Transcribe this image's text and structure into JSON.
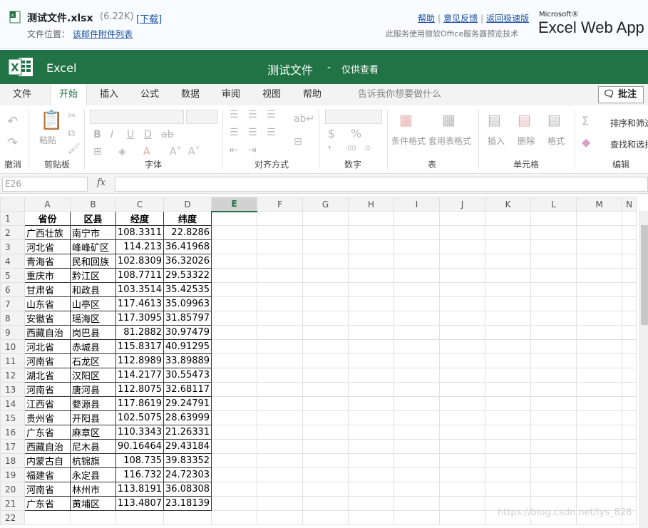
{
  "header": {
    "file_name": "测试文件.xlsx",
    "file_size": "(6.22K)",
    "download_label": "[下载]",
    "location_label": "文件位置：",
    "location_value": "该邮件附件列表",
    "links": [
      "帮助",
      "意见反馈",
      "返回极速版"
    ],
    "service_note": "此服务使用微软Office服务器预览技术",
    "brand_small": "Microsoft®",
    "brand": "Excel Web App"
  },
  "appbar": {
    "app_name": "Excel",
    "doc_title": "测试文件",
    "separator": "-",
    "mode": "仅供查看"
  },
  "tabs": [
    "文件",
    "开始",
    "插入",
    "公式",
    "数据",
    "审阅",
    "视图",
    "帮助"
  ],
  "active_tab": "开始",
  "tell_me": "告诉我你想要做什么",
  "note_button": "批注",
  "ribbon": {
    "groups": [
      "撤消",
      "剪贴板",
      "字体",
      "对齐方式",
      "数字",
      "表",
      "单元格",
      "编辑"
    ],
    "paste": "粘贴",
    "conditional_format": "条件格式",
    "table_format": "套用表格式",
    "insert": "插入",
    "delete": "删除",
    "format": "格式",
    "sort_filter": "排序和筛选",
    "find_select": "查找和选择"
  },
  "formula_bar": {
    "name_box": "E26",
    "fx": "fx",
    "formula": ""
  },
  "sheet": {
    "columns": [
      "A",
      "B",
      "C",
      "D",
      "E",
      "F",
      "G",
      "H",
      "I",
      "J",
      "K",
      "L",
      "M",
      "N"
    ],
    "selected_column": "E",
    "header_row": [
      "省份",
      "区县",
      "经度",
      "纬度"
    ],
    "rows": [
      [
        "广西壮族",
        "南宁市",
        "108.3311",
        "22.8286"
      ],
      [
        "河北省",
        "峰峰矿区",
        "114.213",
        "36.41968"
      ],
      [
        "青海省",
        "民和回族",
        "102.8309",
        "36.32026"
      ],
      [
        "重庆市",
        "黔江区",
        "108.7711",
        "29.53322"
      ],
      [
        "甘肃省",
        "和政县",
        "103.3514",
        "35.42535"
      ],
      [
        "山东省",
        "山亭区",
        "117.4613",
        "35.09963"
      ],
      [
        "安徽省",
        "瑶海区",
        "117.3095",
        "31.85797"
      ],
      [
        "西藏自治",
        "岗巴县",
        "81.2882",
        "30.97479"
      ],
      [
        "河北省",
        "赤城县",
        "115.8317",
        "40.91295"
      ],
      [
        "河南省",
        "石龙区",
        "112.8989",
        "33.89889"
      ],
      [
        "湖北省",
        "汉阳区",
        "114.2177",
        "30.55473"
      ],
      [
        "河南省",
        "唐河县",
        "112.8075",
        "32.68117"
      ],
      [
        "江西省",
        "婺源县",
        "117.8619",
        "29.24791"
      ],
      [
        "贵州省",
        "开阳县",
        "102.5075",
        "28.63999"
      ],
      [
        "广东省",
        "麻章区",
        "110.3343",
        "21.26331"
      ],
      [
        "西藏自治",
        "尼木县",
        "90.16464",
        "29.43184"
      ],
      [
        "内蒙古自",
        "杭锦旗",
        "108.735",
        "39.83352"
      ],
      [
        "福建省",
        "永定县",
        "116.732",
        "24.72303"
      ],
      [
        "河南省",
        "林州市",
        "113.8191",
        "36.08308"
      ],
      [
        "广东省",
        "黄埔区",
        "113.4807",
        "23.18139"
      ]
    ],
    "row_numbers": [
      "1",
      "2",
      "3",
      "4",
      "5",
      "6",
      "7",
      "8",
      "9",
      "10",
      "11",
      "12",
      "13",
      "14",
      "15",
      "16",
      "17",
      "18",
      "19",
      "20",
      "21",
      "22"
    ]
  },
  "watermark": "https://blog.csdn.net/lys_828",
  "colors": {
    "excel_green": "#217346"
  }
}
